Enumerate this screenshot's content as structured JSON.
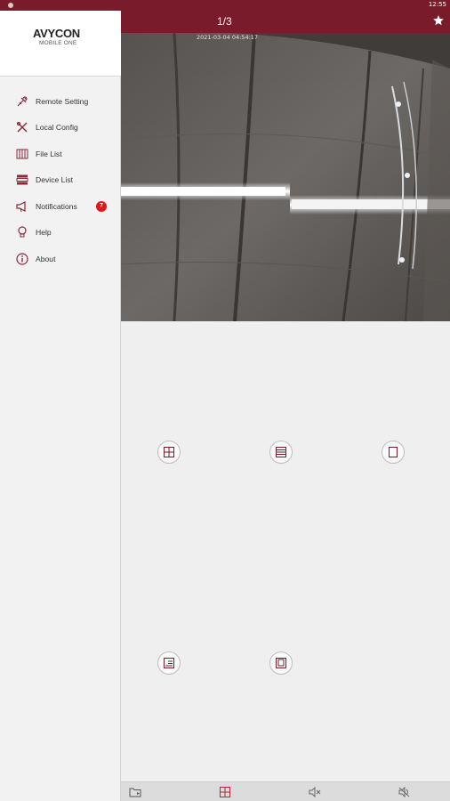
{
  "status_bar": {
    "time": "12:55"
  },
  "sidebar": {
    "brand": "AVYCON",
    "brand_sub": "MOBILE ONE",
    "items": [
      {
        "label": "Remote Setting",
        "icon": "remote-setting-icon"
      },
      {
        "label": "Local Config",
        "icon": "tools-icon"
      },
      {
        "label": "File List",
        "icon": "file-list-icon"
      },
      {
        "label": "Device List",
        "icon": "device-list-icon"
      },
      {
        "label": "Notifications",
        "icon": "megaphone-icon",
        "badge": "7"
      },
      {
        "label": "Help",
        "icon": "lightbulb-icon"
      },
      {
        "label": "About",
        "icon": "info-icon"
      }
    ]
  },
  "header": {
    "page_indicator": "1/3",
    "favorite_icon": "star-icon"
  },
  "video": {
    "osd_timestamp": "2021-03-04 04:54:17"
  },
  "layout_buttons": [
    "grid-4-icon",
    "grid-rows-icon",
    "single-view-icon",
    "page-view-icon",
    "layer-view-icon"
  ],
  "toolbar": {
    "icons": [
      "folder-icon",
      "grid-icon",
      "mute-icon",
      "speaker-off-icon"
    ]
  },
  "colors": {
    "accent": "#7a1b2b",
    "badge": "#e01818"
  }
}
